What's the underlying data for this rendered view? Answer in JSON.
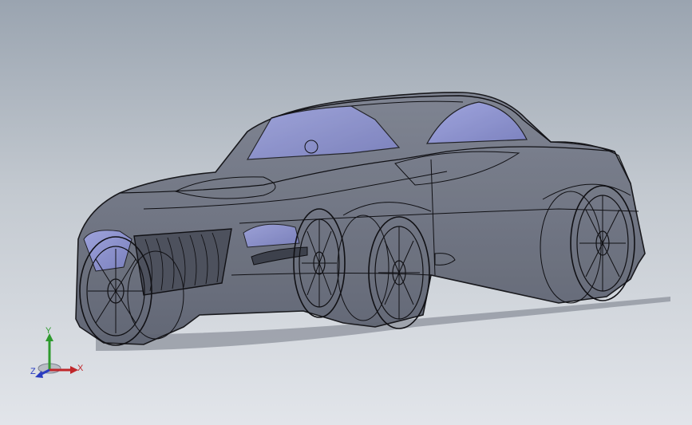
{
  "viewport": {
    "background_top": "#9aa4b0",
    "background_bottom": "#e2e5ea",
    "model": {
      "subject": "sports-car",
      "display_style": "shaded-transparent-with-edges",
      "body_color": "#6f7582",
      "glass_color": "#8e94d6",
      "edge_color": "#101014"
    }
  },
  "triad": {
    "x_label": "X",
    "y_label": "Y",
    "z_label": "Z",
    "x_color": "#c0262a",
    "y_color": "#2e9a2e",
    "z_color": "#2a3cc0"
  }
}
